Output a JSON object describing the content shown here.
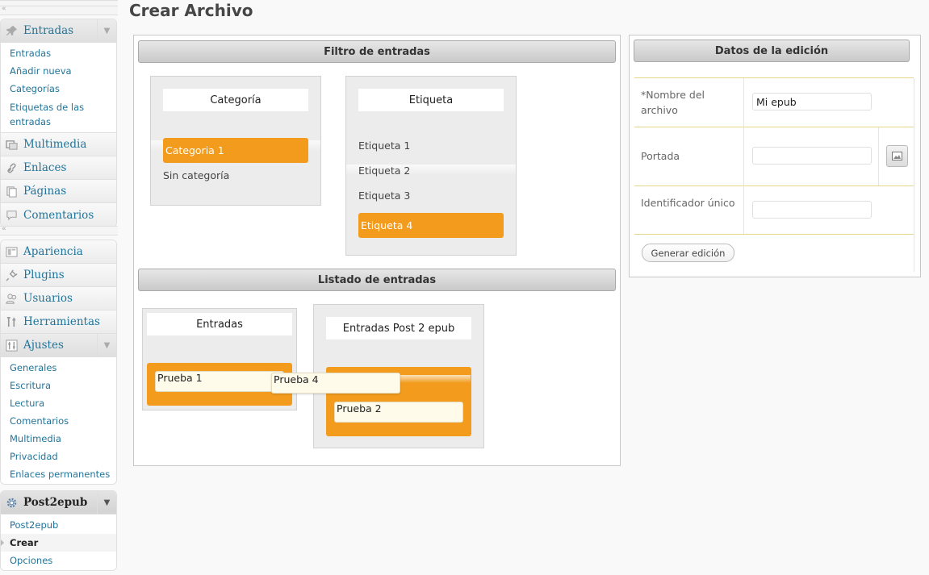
{
  "menu": {
    "collapse_glyph": "«",
    "entradas": {
      "label": "Entradas",
      "icon": "pushpin-icon",
      "items": [
        "Entradas",
        "Añadir nueva",
        "Categorías",
        "Etiquetas de las entradas"
      ]
    },
    "top_items_1": [
      {
        "label": "Multimedia",
        "icon": "media-icon"
      },
      {
        "label": "Enlaces",
        "icon": "link-icon"
      },
      {
        "label": "Páginas",
        "icon": "pages-icon"
      },
      {
        "label": "Comentarios",
        "icon": "comment-icon"
      }
    ],
    "top_items_2": [
      {
        "label": "Apariencia",
        "icon": "appearance-icon"
      },
      {
        "label": "Plugins",
        "icon": "plugin-icon"
      },
      {
        "label": "Usuarios",
        "icon": "users-icon"
      },
      {
        "label": "Herramientas",
        "icon": "tools-icon"
      }
    ],
    "ajustes": {
      "label": "Ajustes",
      "icon": "settings-icon",
      "items": [
        "Generales",
        "Escritura",
        "Lectura",
        "Comentarios",
        "Multimedia",
        "Privacidad",
        "Enlaces permanentes"
      ]
    },
    "post2epub": {
      "label": "Post2epub",
      "icon": "gear-icon",
      "items": [
        "Post2epub",
        "Crear",
        "Opciones"
      ],
      "current": "Crear"
    }
  },
  "page": {
    "title": "Crear Archivo"
  },
  "filter": {
    "title": "Filtro de entradas",
    "categoria": {
      "header": "Categoría",
      "selected": "Categoria 1",
      "other": "Sin categoría"
    },
    "etiqueta": {
      "header": "Etiqueta",
      "items": [
        "Etiqueta 1",
        "Etiqueta 2",
        "Etiqueta 3"
      ],
      "selected": "Etiqueta 4"
    }
  },
  "listado": {
    "title": "Listado de entradas",
    "entradas": {
      "header": "Entradas",
      "items": [
        "Prueba 1"
      ],
      "dragging": "Prueba 4"
    },
    "epub": {
      "header": "Entradas Post 2 epub",
      "items": [
        "Prueba 2"
      ]
    }
  },
  "edition": {
    "title": "Datos de la edición",
    "nombre_label": "*Nombre del archivo",
    "nombre_value": "Mi epub",
    "portada_label": "Portada",
    "portada_value": "",
    "identificador_label": "Identificador único",
    "identificador_value": "",
    "generate_button": "Generar edición"
  },
  "colors": {
    "accent_orange": "#f29b1c",
    "link_blue": "#21759b",
    "row_border": "#e6d789"
  }
}
